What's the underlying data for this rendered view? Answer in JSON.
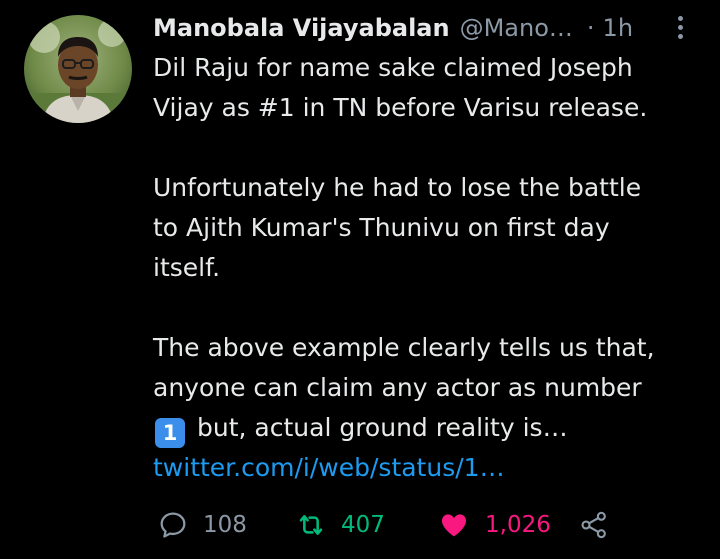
{
  "tweet": {
    "author_name": "Manobala Vijayabalan",
    "handle": "@Mano…",
    "separator": "·",
    "time": "1h",
    "lines": [
      "Dil Raju for name sake claimed Joseph",
      "Vijay as #1 in TN before Varisu release.",
      "",
      "Unfortunately he had to lose the battle",
      "to Ajith Kumar's Thunivu on first day",
      "itself.",
      "",
      "The above example clearly tells us that,",
      "anyone can claim any actor as number"
    ],
    "keycap": "1",
    "last_line": "but, actual ground reality is…",
    "link": "twitter.com/i/web/status/1…"
  },
  "actions": {
    "reply_count": "108",
    "retweet_count": "407",
    "like_count": "1,026"
  },
  "colors": {
    "background": "#000000",
    "text": "#e7e9ea",
    "muted": "#8b98a5",
    "link": "#1d9bf0",
    "retweet_active": "#00ba7c",
    "like_active": "#f91880"
  },
  "icons": [
    "reply-icon",
    "retweet-icon",
    "heart-icon",
    "share-icon",
    "more-icon"
  ]
}
